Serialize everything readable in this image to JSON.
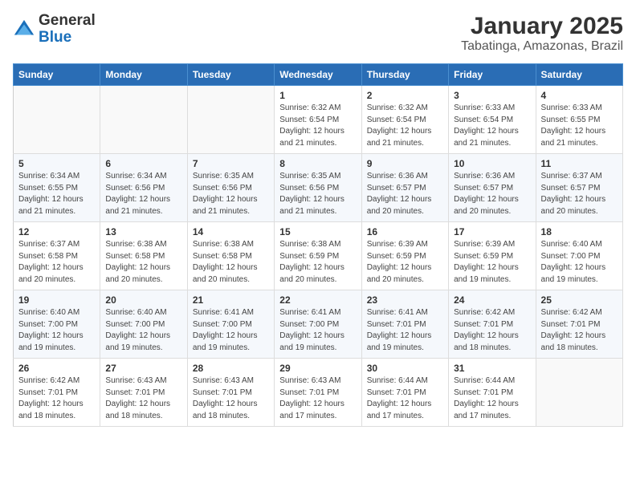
{
  "logo": {
    "text_general": "General",
    "text_blue": "Blue"
  },
  "title": "January 2025",
  "subtitle": "Tabatinga, Amazonas, Brazil",
  "days_of_week": [
    "Sunday",
    "Monday",
    "Tuesday",
    "Wednesday",
    "Thursday",
    "Friday",
    "Saturday"
  ],
  "weeks": [
    [
      {
        "day": "",
        "info": ""
      },
      {
        "day": "",
        "info": ""
      },
      {
        "day": "",
        "info": ""
      },
      {
        "day": "1",
        "info": "Sunrise: 6:32 AM\nSunset: 6:54 PM\nDaylight: 12 hours and 21 minutes."
      },
      {
        "day": "2",
        "info": "Sunrise: 6:32 AM\nSunset: 6:54 PM\nDaylight: 12 hours and 21 minutes."
      },
      {
        "day": "3",
        "info": "Sunrise: 6:33 AM\nSunset: 6:54 PM\nDaylight: 12 hours and 21 minutes."
      },
      {
        "day": "4",
        "info": "Sunrise: 6:33 AM\nSunset: 6:55 PM\nDaylight: 12 hours and 21 minutes."
      }
    ],
    [
      {
        "day": "5",
        "info": "Sunrise: 6:34 AM\nSunset: 6:55 PM\nDaylight: 12 hours and 21 minutes."
      },
      {
        "day": "6",
        "info": "Sunrise: 6:34 AM\nSunset: 6:56 PM\nDaylight: 12 hours and 21 minutes."
      },
      {
        "day": "7",
        "info": "Sunrise: 6:35 AM\nSunset: 6:56 PM\nDaylight: 12 hours and 21 minutes."
      },
      {
        "day": "8",
        "info": "Sunrise: 6:35 AM\nSunset: 6:56 PM\nDaylight: 12 hours and 21 minutes."
      },
      {
        "day": "9",
        "info": "Sunrise: 6:36 AM\nSunset: 6:57 PM\nDaylight: 12 hours and 20 minutes."
      },
      {
        "day": "10",
        "info": "Sunrise: 6:36 AM\nSunset: 6:57 PM\nDaylight: 12 hours and 20 minutes."
      },
      {
        "day": "11",
        "info": "Sunrise: 6:37 AM\nSunset: 6:57 PM\nDaylight: 12 hours and 20 minutes."
      }
    ],
    [
      {
        "day": "12",
        "info": "Sunrise: 6:37 AM\nSunset: 6:58 PM\nDaylight: 12 hours and 20 minutes."
      },
      {
        "day": "13",
        "info": "Sunrise: 6:38 AM\nSunset: 6:58 PM\nDaylight: 12 hours and 20 minutes."
      },
      {
        "day": "14",
        "info": "Sunrise: 6:38 AM\nSunset: 6:58 PM\nDaylight: 12 hours and 20 minutes."
      },
      {
        "day": "15",
        "info": "Sunrise: 6:38 AM\nSunset: 6:59 PM\nDaylight: 12 hours and 20 minutes."
      },
      {
        "day": "16",
        "info": "Sunrise: 6:39 AM\nSunset: 6:59 PM\nDaylight: 12 hours and 20 minutes."
      },
      {
        "day": "17",
        "info": "Sunrise: 6:39 AM\nSunset: 6:59 PM\nDaylight: 12 hours and 19 minutes."
      },
      {
        "day": "18",
        "info": "Sunrise: 6:40 AM\nSunset: 7:00 PM\nDaylight: 12 hours and 19 minutes."
      }
    ],
    [
      {
        "day": "19",
        "info": "Sunrise: 6:40 AM\nSunset: 7:00 PM\nDaylight: 12 hours and 19 minutes."
      },
      {
        "day": "20",
        "info": "Sunrise: 6:40 AM\nSunset: 7:00 PM\nDaylight: 12 hours and 19 minutes."
      },
      {
        "day": "21",
        "info": "Sunrise: 6:41 AM\nSunset: 7:00 PM\nDaylight: 12 hours and 19 minutes."
      },
      {
        "day": "22",
        "info": "Sunrise: 6:41 AM\nSunset: 7:00 PM\nDaylight: 12 hours and 19 minutes."
      },
      {
        "day": "23",
        "info": "Sunrise: 6:41 AM\nSunset: 7:01 PM\nDaylight: 12 hours and 19 minutes."
      },
      {
        "day": "24",
        "info": "Sunrise: 6:42 AM\nSunset: 7:01 PM\nDaylight: 12 hours and 18 minutes."
      },
      {
        "day": "25",
        "info": "Sunrise: 6:42 AM\nSunset: 7:01 PM\nDaylight: 12 hours and 18 minutes."
      }
    ],
    [
      {
        "day": "26",
        "info": "Sunrise: 6:42 AM\nSunset: 7:01 PM\nDaylight: 12 hours and 18 minutes."
      },
      {
        "day": "27",
        "info": "Sunrise: 6:43 AM\nSunset: 7:01 PM\nDaylight: 12 hours and 18 minutes."
      },
      {
        "day": "28",
        "info": "Sunrise: 6:43 AM\nSunset: 7:01 PM\nDaylight: 12 hours and 18 minutes."
      },
      {
        "day": "29",
        "info": "Sunrise: 6:43 AM\nSunset: 7:01 PM\nDaylight: 12 hours and 17 minutes."
      },
      {
        "day": "30",
        "info": "Sunrise: 6:44 AM\nSunset: 7:01 PM\nDaylight: 12 hours and 17 minutes."
      },
      {
        "day": "31",
        "info": "Sunrise: 6:44 AM\nSunset: 7:01 PM\nDaylight: 12 hours and 17 minutes."
      },
      {
        "day": "",
        "info": ""
      }
    ]
  ]
}
